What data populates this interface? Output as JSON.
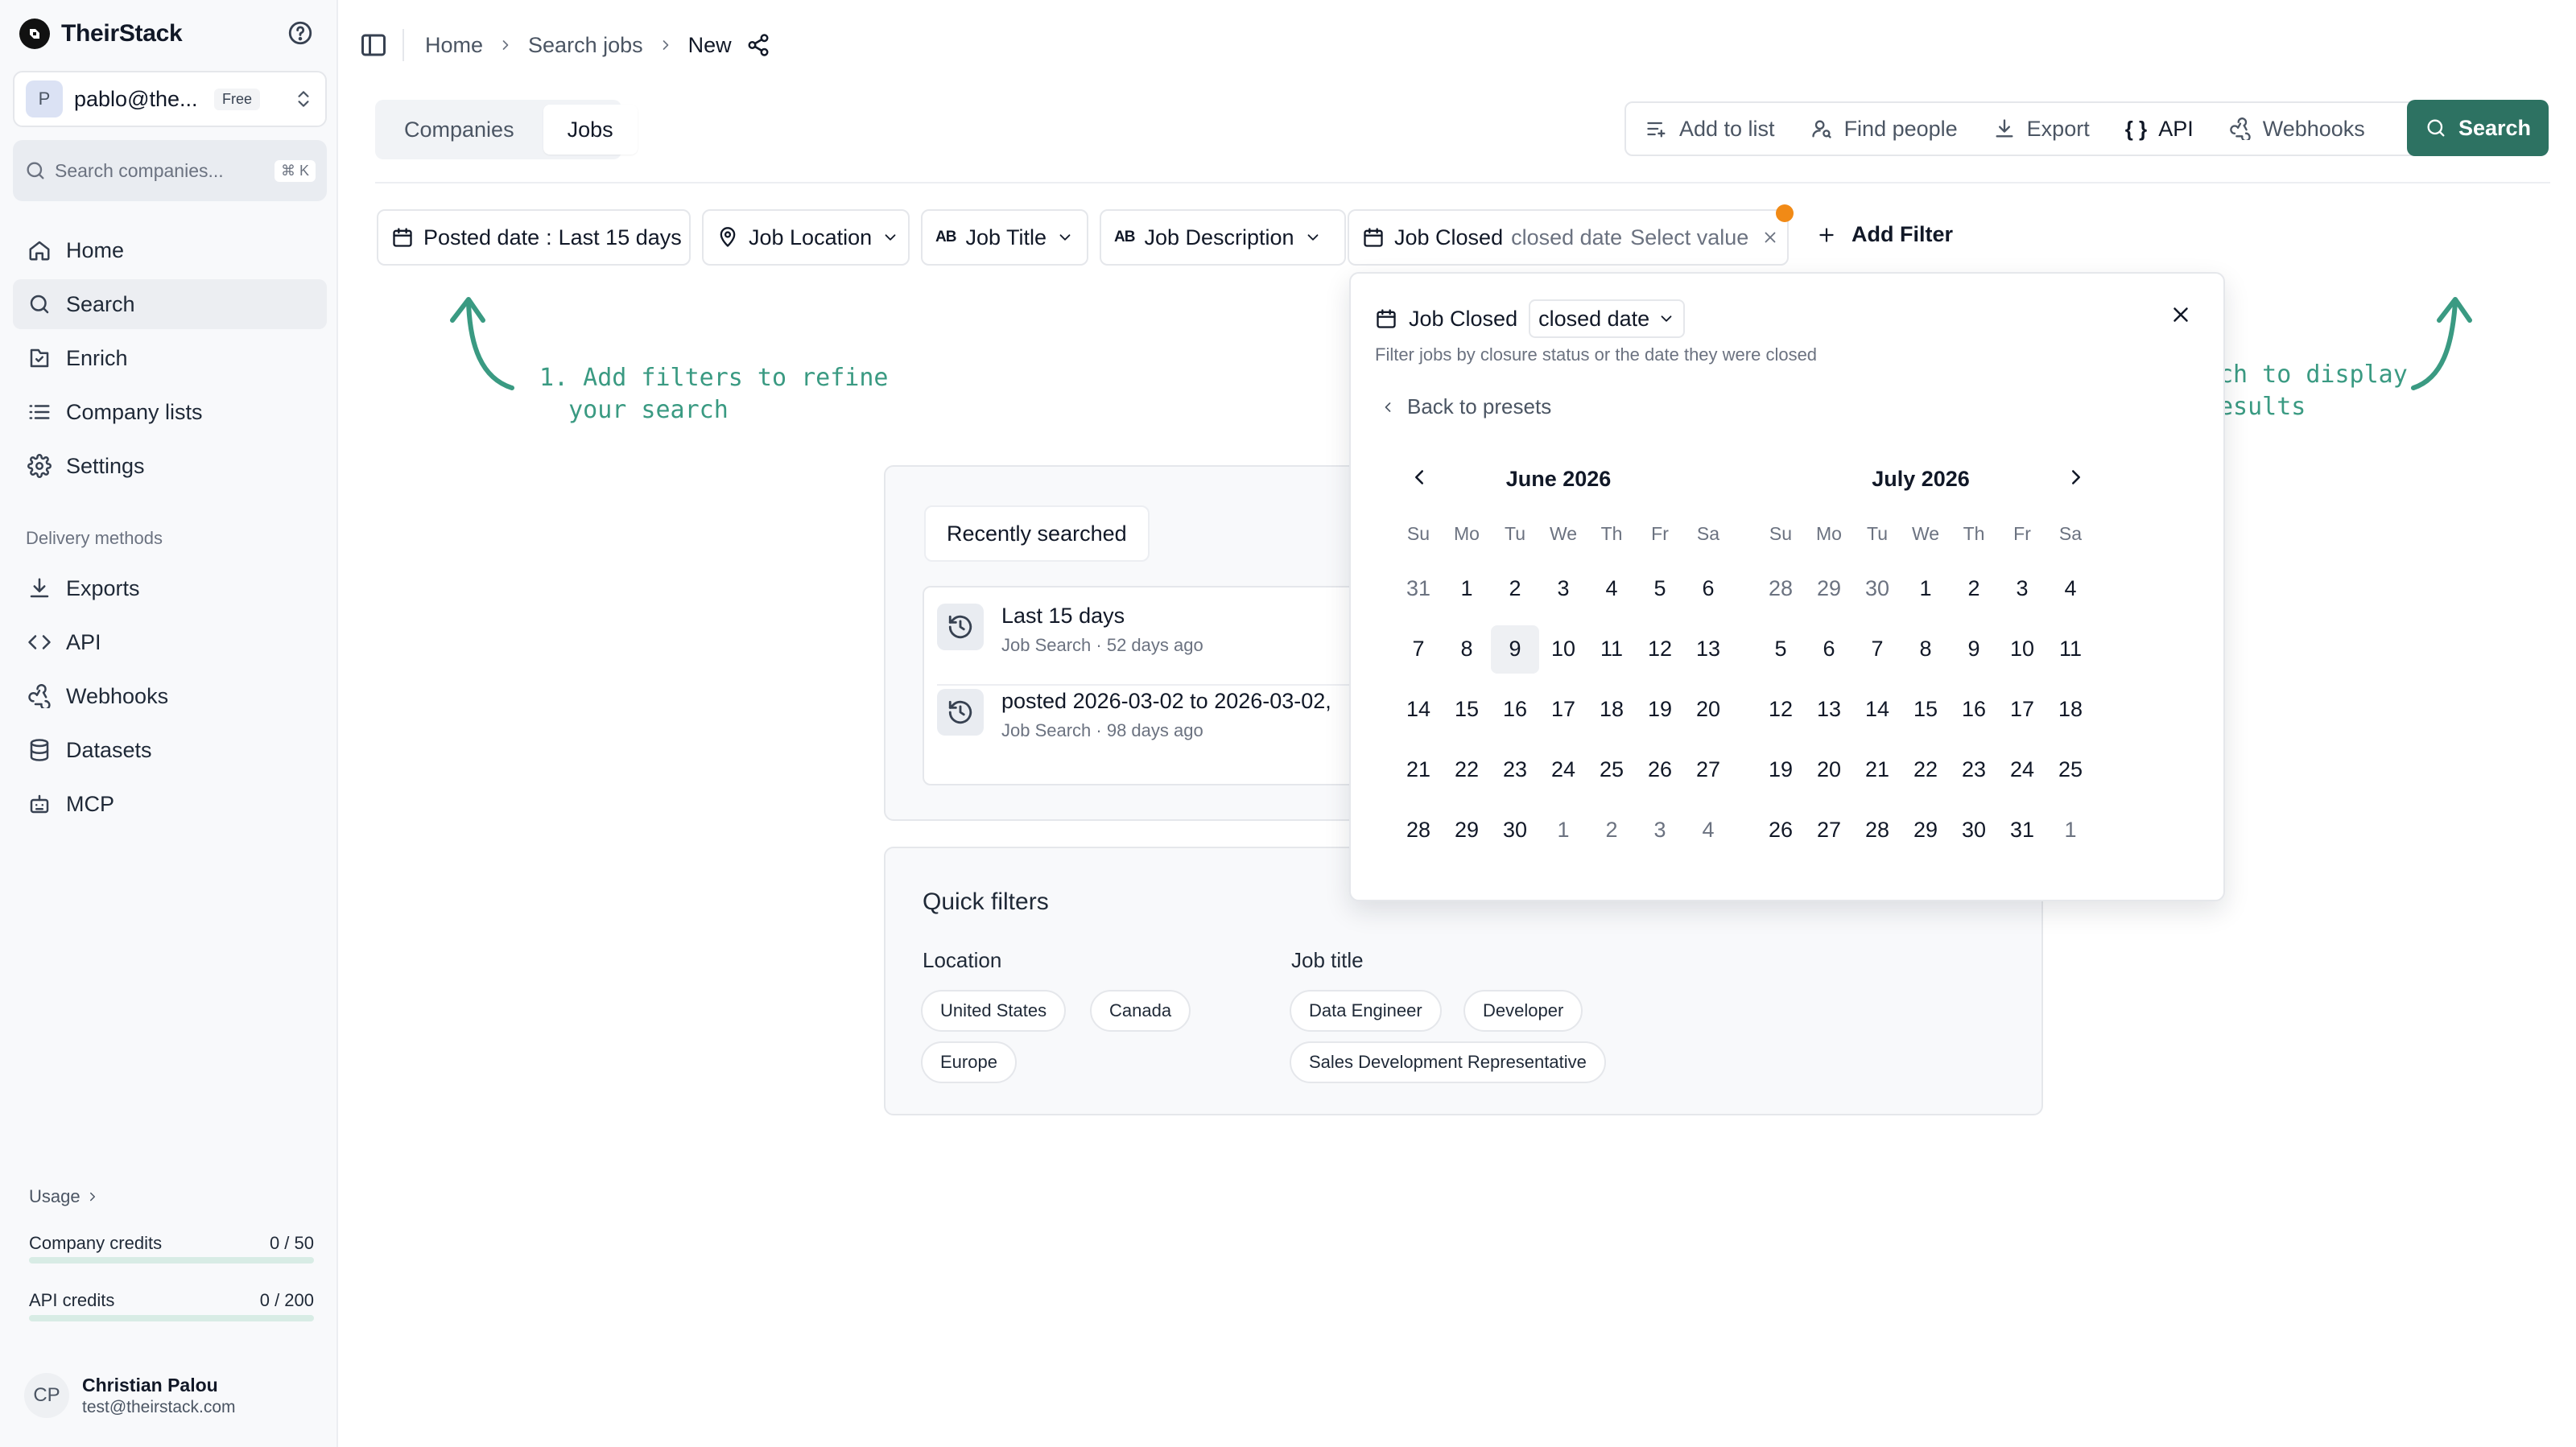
{
  "app": {
    "brand": "TheirStack",
    "account": {
      "initial": "P",
      "email": "pablo@the...",
      "plan": "Free"
    },
    "search": {
      "placeholder": "Search companies...",
      "shortcut": "⌘ K"
    }
  },
  "sidebar": {
    "nav": [
      {
        "label": "Home",
        "icon": "home-icon",
        "active": false
      },
      {
        "label": "Search",
        "icon": "search-icon",
        "active": true
      },
      {
        "label": "Enrich",
        "icon": "enrich-icon",
        "active": false
      },
      {
        "label": "Company lists",
        "icon": "list-icon",
        "active": false
      },
      {
        "label": "Settings",
        "icon": "gear-icon",
        "active": false
      }
    ],
    "delivery_label": "Delivery methods",
    "delivery": [
      {
        "label": "Exports",
        "icon": "download-icon"
      },
      {
        "label": "API",
        "icon": "code-icon"
      },
      {
        "label": "Webhooks",
        "icon": "webhook-icon"
      },
      {
        "label": "Datasets",
        "icon": "database-icon"
      },
      {
        "label": "MCP",
        "icon": "mcp-icon"
      }
    ],
    "usage": {
      "label": "Usage",
      "company_credits": {
        "label": "Company credits",
        "value": "0 / 50",
        "used": 0,
        "total": 50
      },
      "api_credits": {
        "label": "API credits",
        "value": "0 / 200",
        "used": 0,
        "total": 200
      }
    },
    "user": {
      "initials": "CP",
      "name": "Christian Palou",
      "email": "test@theirstack.com"
    }
  },
  "breadcrumb": [
    "Home",
    "Search jobs",
    "New"
  ],
  "tabs": [
    {
      "label": "Companies",
      "active": false
    },
    {
      "label": "Jobs",
      "active": true
    }
  ],
  "actions": {
    "add_to_list": "Add to list",
    "find_people": "Find people",
    "export": "Export",
    "api": "API",
    "api_glyph": "{ }",
    "webhooks": "Webhooks",
    "search": "Search"
  },
  "filters": {
    "posted_date": {
      "label": "Posted date",
      "sep": ":",
      "value": "Last 15 days"
    },
    "job_location": "Job Location",
    "job_title": "Job Title",
    "job_description": "Job Description",
    "ab_glyph": "AB",
    "job_closed": {
      "label": "Job Closed",
      "mode": "closed date",
      "value": "Select value"
    },
    "add_filter": "Add Filter"
  },
  "hints": {
    "left": "1. Add filters to refine\n  your search",
    "right": "ch to display\nesults"
  },
  "recent": {
    "tab_label": "Recently searched",
    "items": [
      {
        "title": "Last 15 days",
        "subtitle": "Job Search · 52 days ago"
      },
      {
        "title": "posted 2026-03-02 to 2026-03-02,",
        "subtitle": "Job Search · 98 days ago"
      }
    ]
  },
  "quick_filters": {
    "title": "Quick filters",
    "location": {
      "label": "Location",
      "options": [
        "United States",
        "Canada",
        "Europe"
      ]
    },
    "job_title": {
      "label": "Job title",
      "options": [
        "Data Engineer",
        "Developer",
        "Sales Development Representative"
      ]
    }
  },
  "date_popover": {
    "title": "Job Closed",
    "mode": "closed date",
    "description": "Filter jobs by closure status or the date they were closed",
    "back": "Back to presets",
    "weekdays": [
      "Su",
      "Mo",
      "Tu",
      "We",
      "Th",
      "Fr",
      "Sa"
    ],
    "months": [
      {
        "title": "June 2026",
        "weeks": [
          [
            "31",
            "1",
            "2",
            "3",
            "4",
            "5",
            "6"
          ],
          [
            "7",
            "8",
            "9",
            "10",
            "11",
            "12",
            "13"
          ],
          [
            "14",
            "15",
            "16",
            "17",
            "18",
            "19",
            "20"
          ],
          [
            "21",
            "22",
            "23",
            "24",
            "25",
            "26",
            "27"
          ],
          [
            "28",
            "29",
            "30",
            "1",
            "2",
            "3",
            "4"
          ]
        ],
        "outside": [
          [
            0,
            0
          ],
          [
            4,
            3
          ],
          [
            4,
            4
          ],
          [
            4,
            5
          ],
          [
            4,
            6
          ]
        ],
        "today": [
          1,
          2
        ]
      },
      {
        "title": "July 2026",
        "weeks": [
          [
            "28",
            "29",
            "30",
            "1",
            "2",
            "3",
            "4"
          ],
          [
            "5",
            "6",
            "7",
            "8",
            "9",
            "10",
            "11"
          ],
          [
            "12",
            "13",
            "14",
            "15",
            "16",
            "17",
            "18"
          ],
          [
            "19",
            "20",
            "21",
            "22",
            "23",
            "24",
            "25"
          ],
          [
            "26",
            "27",
            "28",
            "29",
            "30",
            "31",
            "1"
          ]
        ],
        "outside": [
          [
            0,
            0
          ],
          [
            0,
            1
          ],
          [
            0,
            2
          ],
          [
            4,
            6
          ]
        ],
        "today": null
      }
    ]
  },
  "colors": {
    "primary": "#2d7262",
    "accent_dot": "#f18a16",
    "hint": "#3a9a82"
  }
}
